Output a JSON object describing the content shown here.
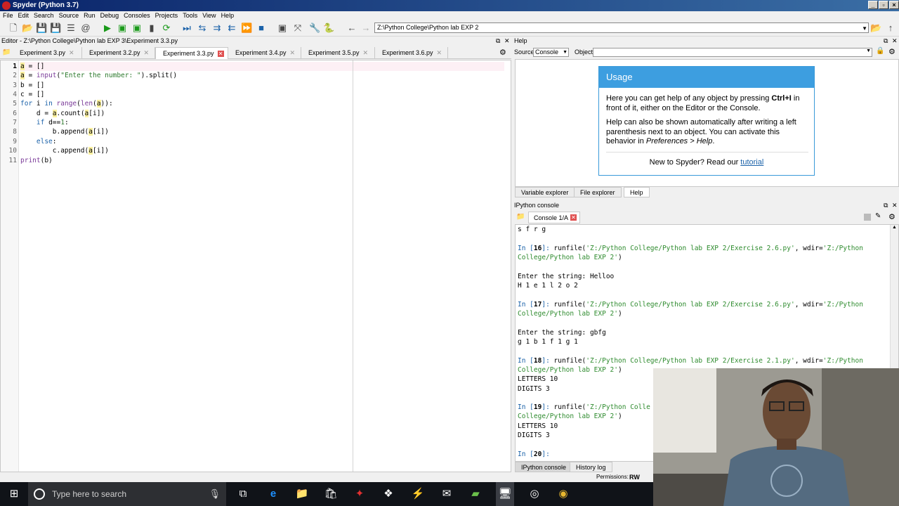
{
  "window": {
    "title": "Spyder (Python 3.7)"
  },
  "menu": [
    "File",
    "Edit",
    "Search",
    "Source",
    "Run",
    "Debug",
    "Consoles",
    "Projects",
    "Tools",
    "View",
    "Help"
  ],
  "toolbar": {
    "path": "Z:\\Python College\\Python lab EXP 2"
  },
  "editor": {
    "title": "Editor - Z:\\Python College\\Python lab EXP 3\\Experiment 3.3.py",
    "tabs": [
      "Experiment 3.py",
      "Experiment 3.2.py",
      "Experiment 3.3.py",
      "Experiment 3.4.py",
      "Experiment 3.5.py",
      "Experiment 3.6.py"
    ],
    "active_tab": 2,
    "line_numbers": [
      "1",
      "2",
      "3",
      "4",
      "5",
      "6",
      "7",
      "8",
      "9",
      "10",
      "11"
    ]
  },
  "help": {
    "title": "Help",
    "source_label": "Source",
    "source_value": "Console",
    "object_label": "Object",
    "usage_title": "Usage",
    "p1_a": "Here you can get help of any object by pressing ",
    "p1_b": "Ctrl+I",
    "p1_c": " in front of it, either on the Editor or the Console.",
    "p2_a": "Help can also be shown automatically after writing a left parenthesis next to an object. You can activate this behavior in ",
    "p2_b": "Preferences > Help",
    "p2_c": ".",
    "p3_a": "New to Spyder? Read our ",
    "p3_link": "tutorial",
    "tabs": [
      "Variable explorer",
      "File explorer",
      "Help"
    ]
  },
  "console": {
    "title": "IPython console",
    "tab": "Console 1/A",
    "bottom_tabs": [
      "IPython console",
      "History log"
    ]
  },
  "status": {
    "permissions_label": "Permissions:",
    "permissions_value": "RW"
  },
  "taskbar": {
    "search_placeholder": "Type here to search"
  }
}
